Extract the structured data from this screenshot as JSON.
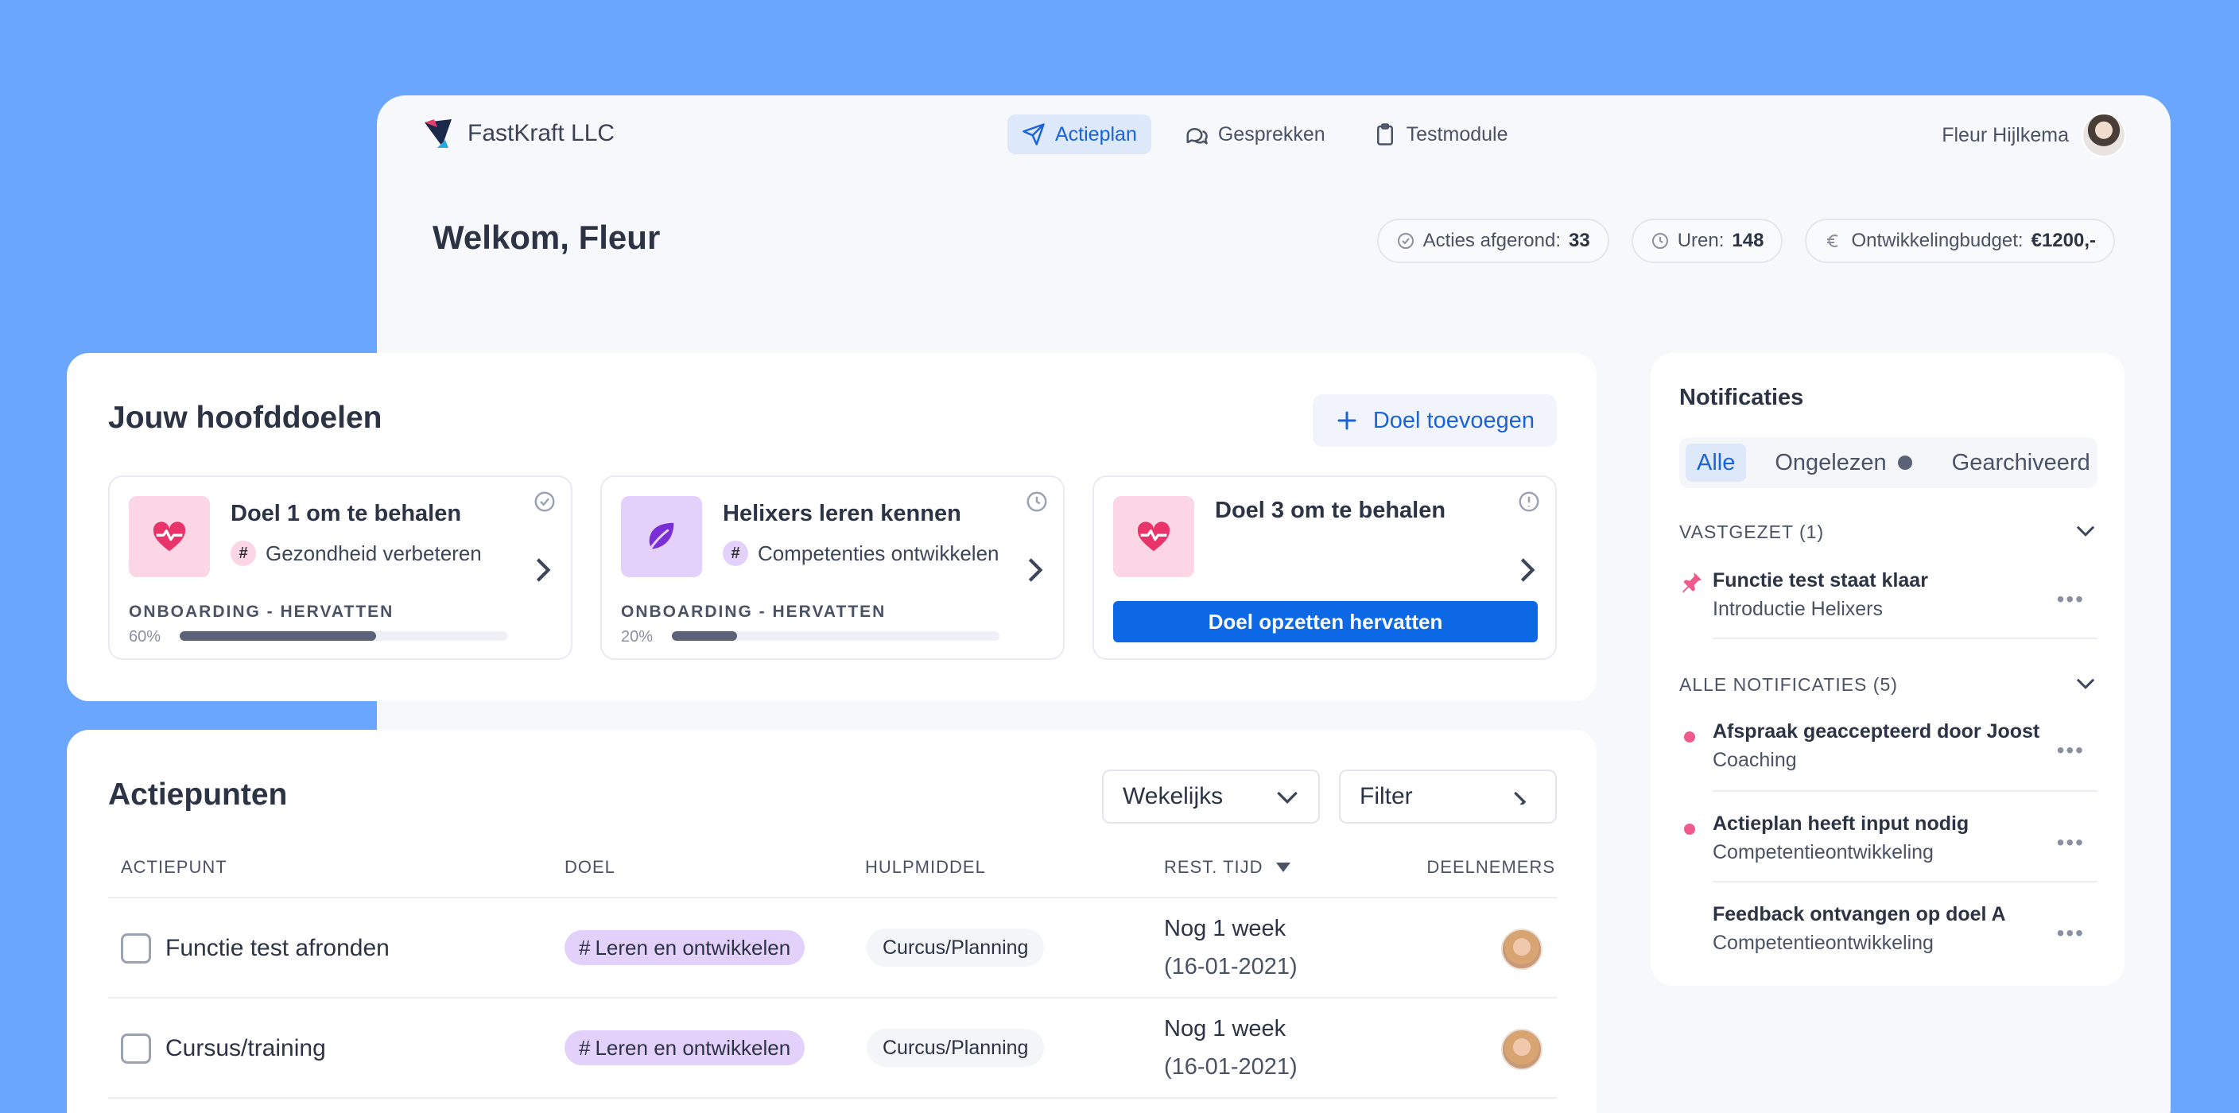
{
  "brand": {
    "name": "FastKraft LLC"
  },
  "nav": [
    {
      "label": "Actieplan",
      "icon": "send-icon",
      "active": true
    },
    {
      "label": "Gesprekken",
      "icon": "chat-icon",
      "active": false
    },
    {
      "label": "Testmodule",
      "icon": "clipboard-icon",
      "active": false
    }
  ],
  "user": {
    "name": "Fleur Hijlkema"
  },
  "welcome": "Welkom, Fleur",
  "stats": [
    {
      "label": "Acties afgerond:",
      "value": "33",
      "icon": "check-circle-icon"
    },
    {
      "label": "Uren:",
      "value": "148",
      "icon": "clock-icon"
    },
    {
      "label": "Ontwikkelingbudget:",
      "value": "€1200,-",
      "icon": "euro-icon"
    }
  ],
  "goals": {
    "title": "Jouw hoofddoelen",
    "add_label": "Doel toevoegen",
    "items": [
      {
        "title": "Doel 1 om te behalen",
        "tag": "Gezondheid verbeteren",
        "progress_label": "ONBOARDING - HERVATTEN",
        "progress_text": "60%",
        "progress": 0.6,
        "icon": "heart-pulse-icon",
        "status_icon": "check-circle-icon",
        "accent": "#fcd6e5"
      },
      {
        "title": "Helixers leren kennen",
        "tag": "Competenties ontwikkelen",
        "progress_label": "ONBOARDING - HERVATTEN",
        "progress_text": "20%",
        "progress": 0.2,
        "icon": "leaf-icon",
        "status_icon": "clock-icon",
        "accent": "#e4d1fb"
      },
      {
        "title": "Doel 3 om te behalen",
        "button_label": "Doel opzetten hervatten",
        "icon": "heart-pulse-icon",
        "status_icon": "alert-circle-icon",
        "accent": "#fcd6e5"
      }
    ]
  },
  "actions": {
    "title": "Actiepunten",
    "period": "Wekelijks",
    "filter": "Filter",
    "columns": [
      "ACTIEPUNT",
      "DOEL",
      "HULPMIDDEL",
      "REST. TIJD",
      "DEELNEMERS"
    ],
    "rows": [
      {
        "name": "Functie test afronden",
        "doel": "Leren en ontwikkelen",
        "hulpmiddel": "Curcus/Planning",
        "time": "Nog 1 week",
        "date": "(16-01-2021)"
      },
      {
        "name": "Cursus/training",
        "doel": "Leren en ontwikkelen",
        "hulpmiddel": "Curcus/Planning",
        "time": "Nog 1 week",
        "date": "(16-01-2021)"
      }
    ]
  },
  "notifications": {
    "title": "Notificaties",
    "tabs": [
      "Alle",
      "Ongelezen",
      "Gearchiveerd"
    ],
    "pinned_header": "VASTGEZET (1)",
    "pinned": [
      {
        "title": "Functie test staat klaar",
        "sub": "Introductie Helixers"
      }
    ],
    "all_header": "ALLE NOTIFICATIES (5)",
    "all": [
      {
        "title": "Afspraak geaccepteerd door Joost",
        "sub": "Coaching",
        "unread": true
      },
      {
        "title": "Actieplan heeft input nodig",
        "sub": "Competentieontwikkeling",
        "unread": true
      },
      {
        "title": "Feedback ontvangen op doel A",
        "sub": "Competentieontwikkeling",
        "unread": false
      }
    ]
  },
  "colors": {
    "background": "#6ba6fe",
    "accent": "#0c68e4",
    "pink": "#fcd6e5",
    "purple": "#e4d1fb",
    "unread_dot": "#ee5a8c"
  }
}
